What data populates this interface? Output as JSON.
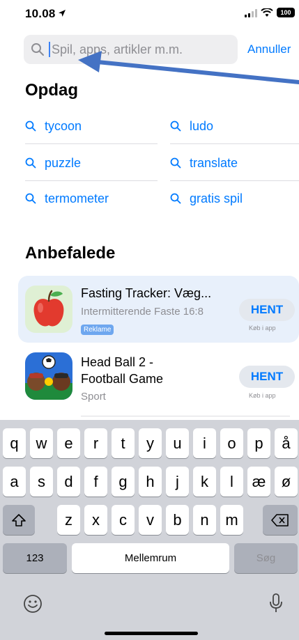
{
  "status_bar": {
    "time": "10.08",
    "battery": "100"
  },
  "search": {
    "placeholder": "Spil, apps, artikler m.m.",
    "cancel_label": "Annuller"
  },
  "discover": {
    "title": "Opdag",
    "items": [
      "tycoon",
      "ludo",
      "puzzle",
      "translate",
      "termometer",
      "gratis spil"
    ]
  },
  "recommended": {
    "title": "Anbefalede",
    "apps": [
      {
        "name": "Fasting Tracker: Væg...",
        "subtitle": "Intermitterende Faste 16:8",
        "badge": "Reklame",
        "button": "HENT",
        "inapp": "Køb i app"
      },
      {
        "name_line1": "Head Ball 2 -",
        "name_line2": "Football Game",
        "subtitle": "Sport",
        "button": "HENT",
        "inapp": "Køb i app"
      }
    ]
  },
  "keyboard": {
    "row1": [
      "q",
      "w",
      "e",
      "r",
      "t",
      "y",
      "u",
      "i",
      "o",
      "p",
      "å"
    ],
    "row2": [
      "a",
      "s",
      "d",
      "f",
      "g",
      "h",
      "j",
      "k",
      "l",
      "æ",
      "ø"
    ],
    "row3": [
      "z",
      "x",
      "c",
      "v",
      "b",
      "n",
      "m"
    ],
    "numbers_label": "123",
    "space_label": "Mellemrum",
    "search_label": "Søg"
  },
  "colors": {
    "accent": "#007aff",
    "keyboard_bg": "#d1d3d9",
    "arrow": "#4472c4"
  }
}
